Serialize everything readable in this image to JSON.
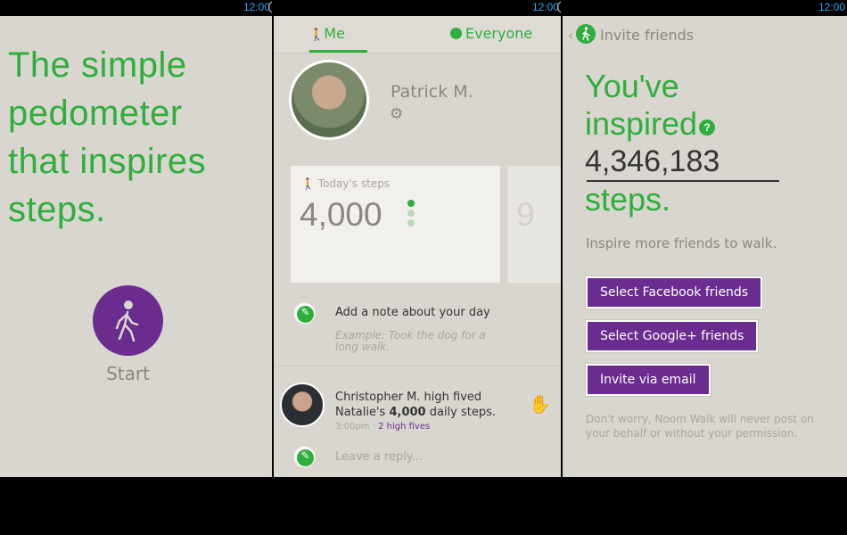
{
  "status_bar": {
    "time": "12:00"
  },
  "screen1": {
    "tagline": [
      "The simple",
      "pedometer",
      "that inspires",
      "steps."
    ],
    "start_label": "Start"
  },
  "screen2": {
    "tabs": [
      {
        "label": "Me"
      },
      {
        "label": "Everyone"
      }
    ],
    "active_tab": "Me",
    "user_name": "Patrick M.",
    "card": {
      "label": "Today's steps",
      "value": "4,000",
      "next_value_partial": "9"
    },
    "note": {
      "title": "Add a note about your day",
      "example": "Example: Took the dog for a long walk."
    },
    "feed": {
      "text_before": "Christopher M. high fived Natalie's ",
      "text_bold": "4,000",
      "text_after": " daily steps.",
      "time": "3:00pm",
      "separator": "·",
      "high_fives": "2 high fives",
      "reply_placeholder": "Leave a reply..."
    }
  },
  "screen3": {
    "header_title": "Invite friends",
    "line1": "You've",
    "line2": "inspired",
    "help": "?",
    "count": "4,346,183",
    "line4": "steps.",
    "subtitle": "Inspire more friends to walk.",
    "buttons": {
      "facebook": "Select Facebook friends",
      "google": "Select Google+ friends",
      "email": "Invite via email"
    },
    "disclaimer": "Don't worry, Noom Walk will never post on your behalf or without your permission."
  },
  "colors": {
    "green": "#2eae3c",
    "purple": "#6a2c8e",
    "background": "#d9d6cf",
    "status_blue": "#33a7e8"
  },
  "icons": [
    "walker-icon",
    "globe-icon",
    "gear-icon",
    "pencil-icon",
    "hand-icon",
    "help-icon",
    "back-arrow-icon",
    "noom-icon"
  ]
}
